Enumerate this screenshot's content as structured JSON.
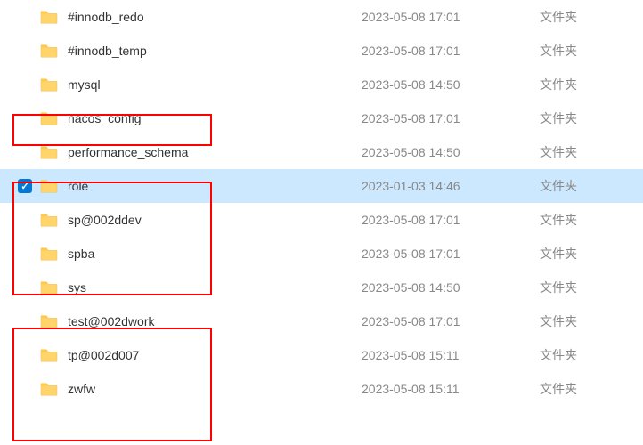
{
  "rows": [
    {
      "name": "#innodb_redo",
      "date": "2023-05-08 17:01",
      "type": "文件夹",
      "selected": false
    },
    {
      "name": "#innodb_temp",
      "date": "2023-05-08 17:01",
      "type": "文件夹",
      "selected": false
    },
    {
      "name": "mysql",
      "date": "2023-05-08 14:50",
      "type": "文件夹",
      "selected": false
    },
    {
      "name": "nacos_config",
      "date": "2023-05-08 17:01",
      "type": "文件夹",
      "selected": false
    },
    {
      "name": "performance_schema",
      "date": "2023-05-08 14:50",
      "type": "文件夹",
      "selected": false
    },
    {
      "name": "role",
      "date": "2023-01-03 14:46",
      "type": "文件夹",
      "selected": true
    },
    {
      "name": "sp@002ddev",
      "date": "2023-05-08 17:01",
      "type": "文件夹",
      "selected": false
    },
    {
      "name": "spba",
      "date": "2023-05-08 17:01",
      "type": "文件夹",
      "selected": false
    },
    {
      "name": "sys",
      "date": "2023-05-08 14:50",
      "type": "文件夹",
      "selected": false
    },
    {
      "name": "test@002dwork",
      "date": "2023-05-08 17:01",
      "type": "文件夹",
      "selected": false
    },
    {
      "name": "tp@002d007",
      "date": "2023-05-08 15:11",
      "type": "文件夹",
      "selected": false
    },
    {
      "name": "zwfw",
      "date": "2023-05-08 15:11",
      "type": "文件夹",
      "selected": false
    }
  ],
  "highlights": [
    {
      "start": 3,
      "end": 3
    },
    {
      "start": 5,
      "end": 7
    },
    {
      "start": 9,
      "end": 11
    }
  ]
}
